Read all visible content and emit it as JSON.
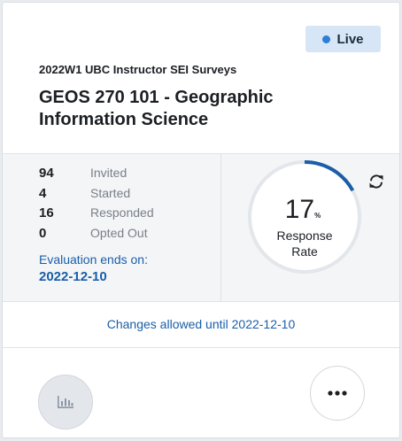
{
  "badge": {
    "label": "Live",
    "dot_color": "#2d7fd6"
  },
  "survey": {
    "name": "2022W1 UBC Instructor SEI Surveys"
  },
  "course": {
    "title": "GEOS 270 101 - Geographic Information Science"
  },
  "stats": [
    {
      "value": "94",
      "label": "Invited"
    },
    {
      "value": "4",
      "label": "Started"
    },
    {
      "value": "16",
      "label": "Responded"
    },
    {
      "value": "0",
      "label": "Opted Out"
    }
  ],
  "evaluation": {
    "label": "Evaluation ends on:",
    "date": "2022-12-10"
  },
  "response_rate": {
    "value": "17",
    "unit": "%",
    "caption_line1": "Response",
    "caption_line2": "Rate",
    "fraction": 0.17,
    "accent": "#1a5ea8"
  },
  "changes": {
    "text": "Changes allowed until 2022-12-10"
  },
  "icons": {
    "refresh": "refresh-icon",
    "chart": "bar-chart-icon",
    "more": "more-options-icon"
  }
}
